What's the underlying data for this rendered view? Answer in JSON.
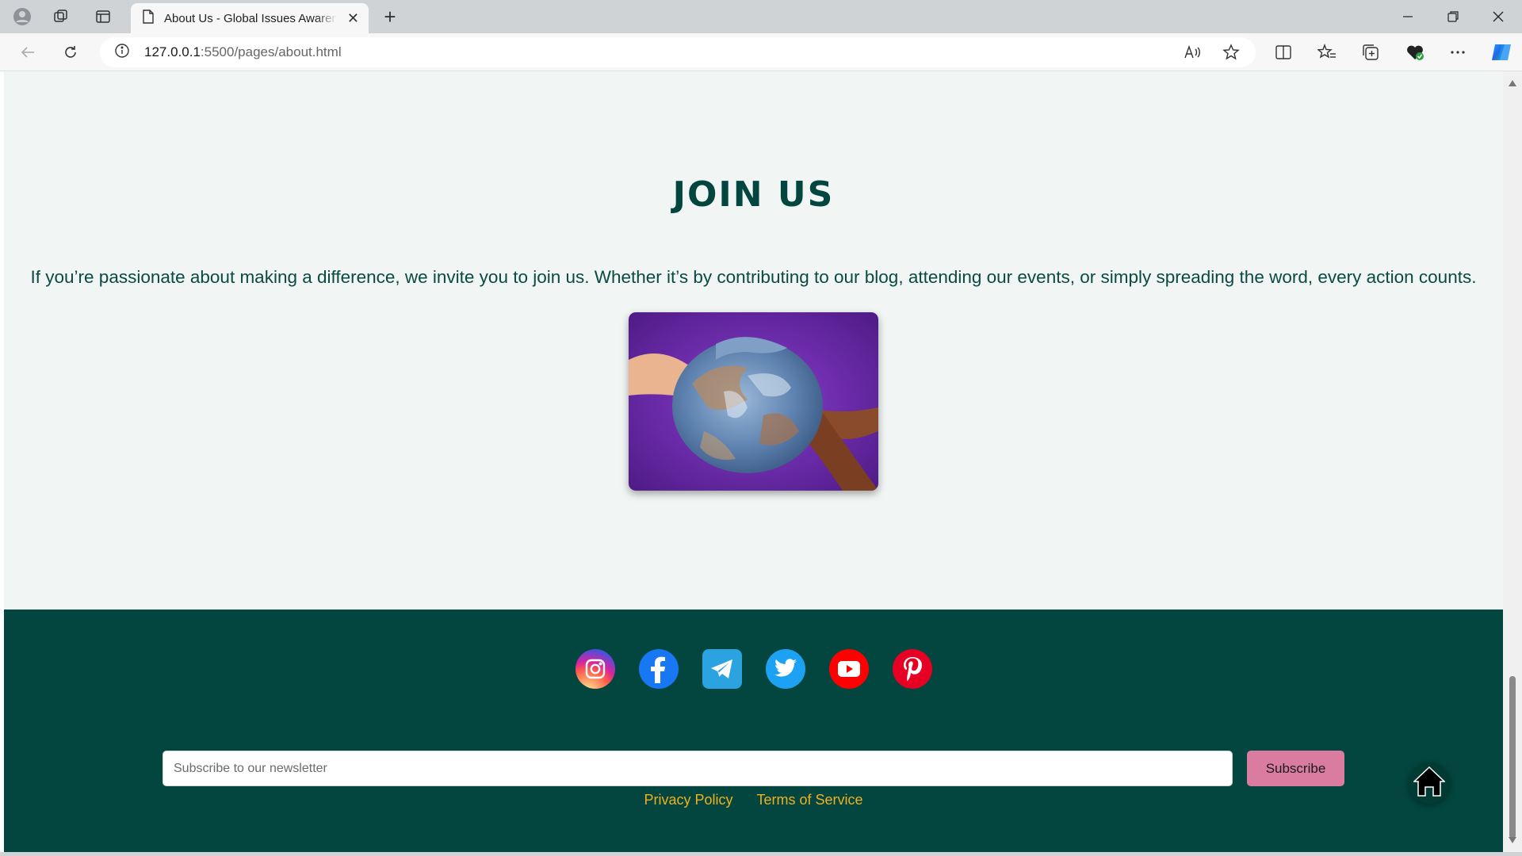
{
  "browser": {
    "tab_title": "About Us - Global Issues Awareness",
    "url_host": "127.0.0.1",
    "url_rest": ":5500/pages/about.html",
    "icons": [
      "profile-icon",
      "workspaces-icon",
      "tab-actions-icon",
      "page-icon",
      "close-icon",
      "new-tab-icon",
      "minimize-icon",
      "restore-icon",
      "window-close-icon",
      "back-icon",
      "refresh-icon",
      "info-icon",
      "read-aloud-icon",
      "favorite-star-icon",
      "split-screen-icon",
      "favorites-icon",
      "collections-icon",
      "browser-essentials-icon",
      "more-icon",
      "copilot-icon"
    ]
  },
  "join": {
    "title": "JOIN US",
    "text": "If you’re passionate about making a difference, we invite you to join us. Whether it’s by contributing to our blog, attending our events, or simply spreading the word, every action counts."
  },
  "footer": {
    "socials": [
      "instagram-icon",
      "facebook-icon",
      "telegram-icon",
      "twitter-icon",
      "youtube-icon",
      "pinterest-icon"
    ],
    "newsletter_placeholder": "Subscribe to our newsletter",
    "subscribe_label": "Subscribe",
    "links": [
      "Privacy Policy",
      "Terms of Service"
    ],
    "colors": {
      "footer_bg": "#03463f",
      "accent": "#f0b020",
      "button": "#d97ca0",
      "heading": "#03463f"
    }
  }
}
